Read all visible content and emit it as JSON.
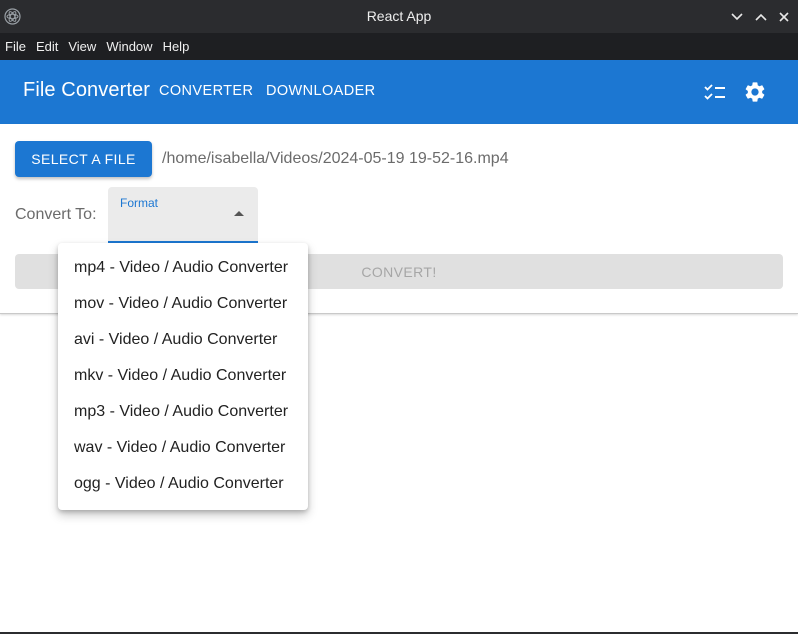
{
  "window": {
    "title": "React App",
    "icons": [
      "app-icon",
      "chevron-down-icon",
      "chevron-up-icon",
      "close-icon"
    ]
  },
  "menubar": {
    "items": [
      "File",
      "Edit",
      "View",
      "Window",
      "Help"
    ]
  },
  "appbar": {
    "brand": "File Converter",
    "tabs": [
      "CONVERTER",
      "DOWNLOADER"
    ],
    "icons": [
      "checklist-icon",
      "gear-icon"
    ],
    "color": "#1c77d2"
  },
  "main": {
    "select_button": "SELECT A FILE",
    "file_path": "/home/isabella/Videos/2024-05-19 19-52-16.mp4",
    "convert_to_label": "Convert To:",
    "format_field": {
      "label": "Format",
      "value": ""
    },
    "convert_button": "CONVERT!"
  },
  "dropdown": {
    "options": [
      "mp4 - Video / Audio Converter",
      "mov - Video / Audio Converter",
      "avi - Video / Audio Converter",
      "mkv - Video / Audio Converter",
      "mp3 - Video / Audio Converter",
      "wav - Video / Audio Converter",
      "ogg - Video / Audio Converter"
    ]
  }
}
